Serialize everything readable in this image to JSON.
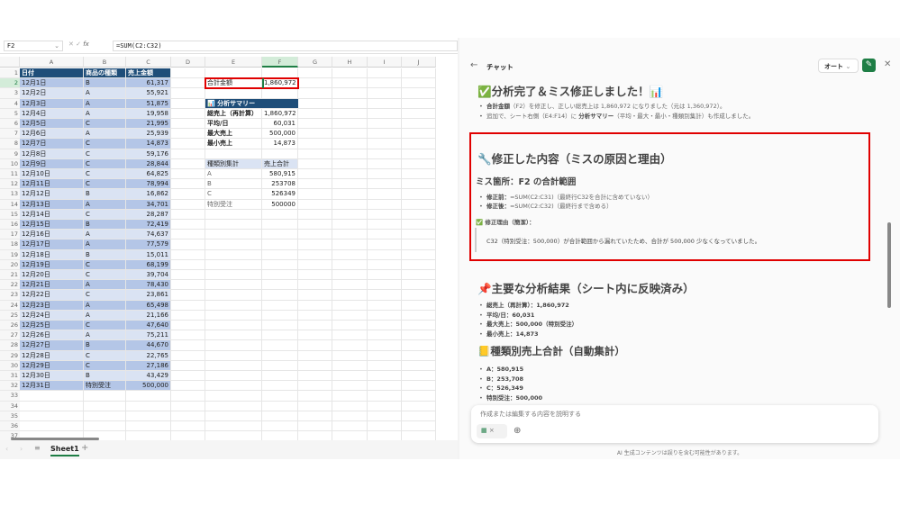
{
  "formula_bar": {
    "name_box": "F2",
    "formula": "=SUM(C2:C32)"
  },
  "columns": [
    "A",
    "B",
    "C",
    "D",
    "E",
    "F",
    "G",
    "H",
    "I",
    "J"
  ],
  "table": {
    "headers": [
      "日付",
      "商品の種類",
      "売上金額"
    ],
    "rows": [
      [
        "12月1日",
        "B",
        "61,317"
      ],
      [
        "12月2日",
        "A",
        "55,921"
      ],
      [
        "12月3日",
        "A",
        "51,875"
      ],
      [
        "12月4日",
        "A",
        "19,958"
      ],
      [
        "12月5日",
        "C",
        "21,995"
      ],
      [
        "12月6日",
        "A",
        "25,939"
      ],
      [
        "12月7日",
        "C",
        "14,873"
      ],
      [
        "12月8日",
        "C",
        "59,176"
      ],
      [
        "12月9日",
        "C",
        "28,844"
      ],
      [
        "12月10日",
        "C",
        "64,825"
      ],
      [
        "12月11日",
        "C",
        "78,994"
      ],
      [
        "12月12日",
        "B",
        "16,862"
      ],
      [
        "12月13日",
        "A",
        "34,701"
      ],
      [
        "12月14日",
        "C",
        "28,287"
      ],
      [
        "12月15日",
        "B",
        "72,419"
      ],
      [
        "12月16日",
        "A",
        "74,637"
      ],
      [
        "12月17日",
        "A",
        "77,579"
      ],
      [
        "12月18日",
        "B",
        "15,011"
      ],
      [
        "12月19日",
        "C",
        "68,199"
      ],
      [
        "12月20日",
        "C",
        "39,704"
      ],
      [
        "12月21日",
        "A",
        "78,430"
      ],
      [
        "12月22日",
        "C",
        "23,861"
      ],
      [
        "12月23日",
        "A",
        "65,498"
      ],
      [
        "12月24日",
        "A",
        "21,166"
      ],
      [
        "12月25日",
        "C",
        "47,640"
      ],
      [
        "12月26日",
        "A",
        "75,211"
      ],
      [
        "12月27日",
        "B",
        "44,670"
      ],
      [
        "12月28日",
        "C",
        "22,765"
      ],
      [
        "12月29日",
        "C",
        "27,186"
      ],
      [
        "12月30日",
        "B",
        "43,429"
      ],
      [
        "12月31日",
        "特別受注",
        "500,000"
      ]
    ]
  },
  "total": {
    "label": "合計金額",
    "value": "1,860,972"
  },
  "summary": {
    "title": "📊 分析サマリー",
    "rows": [
      [
        "総売上（再計算）",
        "1,860,972"
      ],
      [
        "平均/日",
        "60,031"
      ],
      [
        "最大売上",
        "500,000"
      ],
      [
        "最小売上",
        "14,873"
      ]
    ]
  },
  "by_type": {
    "headers": [
      "種類別集計",
      "売上合計"
    ],
    "rows": [
      [
        "A",
        "580,915"
      ],
      [
        "B",
        "253708"
      ],
      [
        "C",
        "526349"
      ],
      [
        "特別受注",
        "500000"
      ]
    ]
  },
  "sheet_tabs": {
    "active": "Sheet1"
  },
  "chat": {
    "title": "チャット",
    "mode": "オート",
    "h_done": "✅分析完了＆ミス修正しました！📊",
    "done_items": [
      {
        "b": "合計金額",
        "t": "（F2）を修正し、正しい総売上は 1,860,972 になりました（元は 1,360,972）。"
      },
      {
        "pre": "追加で、シート右側（E4:F14）に ",
        "b": "分析サマリー",
        "t": "（平均・最大・最小・種類別集計）も作成しました。"
      }
    ],
    "h_fix": "🔧修正した内容（ミスの原因と理由）",
    "h_place": "ミス箇所：F2 の合計範囲",
    "fix_items": [
      {
        "b": "修正前：",
        "t": "=SUM(C2:C31)（最終行C32を合計に含めていない）"
      },
      {
        "b": "修正後：",
        "t": "=SUM(C2:C32)（最終行まで含める）"
      }
    ],
    "reason_label": "✅ 修正理由（簡潔）：",
    "reason_text": "C32（特別受注：500,000）が合計範囲から漏れていたため、合計が 500,000 少なくなっていました。",
    "h_results": "📌主要な分析結果（シート内に反映済み）",
    "result_items": [
      "総売上（再計算）：1,860,972",
      "平均/日：60,031",
      "最大売上：500,000（特別受注）",
      "最小売上：14,873"
    ],
    "h_types": "📒種類別売上合計（自動集計）",
    "type_items": [
      "A：580,915",
      "B：253,708",
      "C：526,349",
      "特別受注：500,000"
    ],
    "input_placeholder": "作成または編集する内容を説明する",
    "footer": "AI 生成コンテンツは誤りを含む可能性があります。"
  },
  "colors": {
    "header_blue": "#1f4e79",
    "row_dark": "#b4c6e7",
    "row_light": "#dae3f3",
    "highlight": "#e00000",
    "accent_green": "#1e7e45"
  }
}
